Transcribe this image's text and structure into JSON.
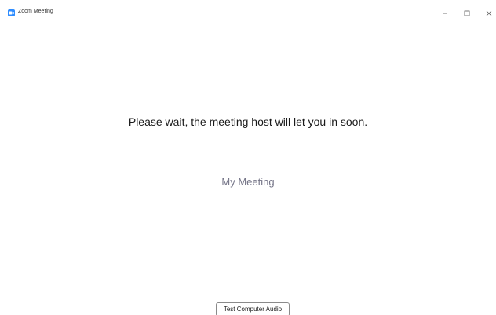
{
  "window": {
    "title": "Zoom Meeting",
    "icon": "zoom-logo-icon",
    "controls": [
      "minimize-icon",
      "maximize-icon",
      "close-icon"
    ]
  },
  "main": {
    "message": "Please wait, the meeting host will let you in soon.",
    "meeting_name": "My Meeting"
  },
  "footer": {
    "test_audio_label": "Test Computer Audio"
  },
  "colors": {
    "accent": "#2d8cff",
    "meeting_name": "#747487",
    "text": "#1a1a1a",
    "background": "#ffffff"
  }
}
